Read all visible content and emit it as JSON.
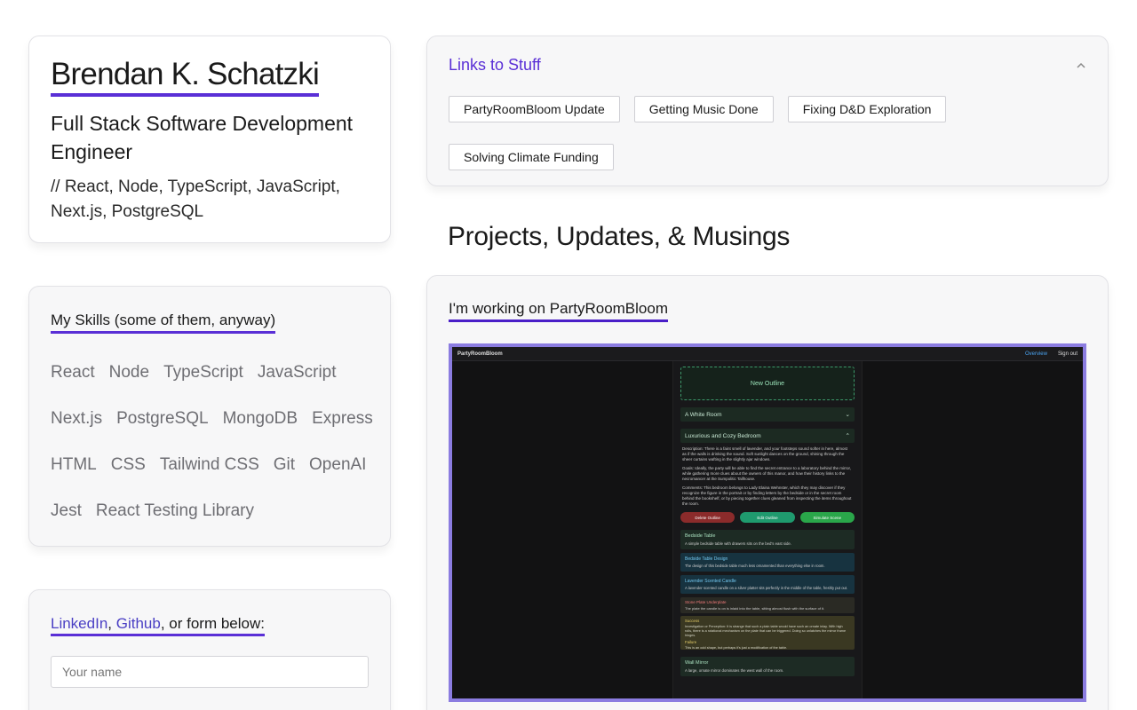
{
  "profile": {
    "name": "Brendan K. Schatzki",
    "role": "Full Stack Software Development Engineer",
    "stack": "// React, Node, TypeScript, JavaScript, Next.js, PostgreSQL"
  },
  "skills": {
    "heading": "My Skills (some of them, anyway)",
    "items": [
      "React",
      "Node",
      "TypeScript",
      "JavaScript",
      "Next.js",
      "PostgreSQL",
      "MongoDB",
      "Express",
      "HTML",
      "CSS",
      "Tailwind CSS",
      "Git",
      "OpenAI",
      "Jest",
      "React Testing Library"
    ]
  },
  "contact": {
    "linkedin": "LinkedIn",
    "separator": ",",
    "github": "Github",
    "suffix": ", or form below:",
    "name_placeholder": "Your name"
  },
  "links": {
    "title": "Links to Stuff",
    "items": [
      "PartyRoomBloom Update",
      "Getting Music Done",
      "Fixing D&D Exploration",
      "Solving Climate Funding"
    ]
  },
  "section": {
    "title": "Projects, Updates, & Musings"
  },
  "post": {
    "title": "I'm working on PartyRoomBloom",
    "screenshot": {
      "brand": "PartyRoomBloom",
      "nav_overview": "Overview",
      "nav_signout": "Sign out",
      "new_outline": "New Outline",
      "room_1": "A White Room",
      "room_2": "Luxurious and Cozy Bedroom",
      "description": "Description: There is a faint smell of lavender, and your footsteps sound softer in here, almost as if the walls is drinking the sound. Soft sunlight dances on the ground, shining through the sheer curtains wafting in the slightly ajar windows.",
      "goals": "Goals: Ideally, the party will be able to find the secret entrance to a laboratory behind the mirror, while gathering more clues about the owners of this manor, and how their history links to the necromancer at the Sumpolitic Tallhouse.",
      "comments": "Comments: This bedroom belongs to Lady Elaina Wehnster, which they may discover if they recognize the figure in the portrait or by finding letters by the bedside or in the secret room behind the bookshelf, or by piecing together clues gleaned from inspecting the items throughout the room.",
      "btn_delete": "Delete Outline",
      "btn_edit": "Edit Outline",
      "btn_simulate": "Simulate Scene",
      "sub_1_title": "Bedside Table",
      "sub_1_desc": "A simple bedside table with drawers sits on the bed's east side.",
      "sub_2_title": "Bedside Table Design",
      "sub_2_desc": "The design of this bedside table much less ornamented than everything else in room.",
      "sub_3_title": "Lavender Scented Candle",
      "sub_3_desc": "A lavender scented candle on a silver platter sits perfectly in the middle of the table, freshly put out.",
      "sub_4_title": "Stone Plate Underplate",
      "sub_4_desc": "The plate the candle is on is inlaid into the table, sitting almost flush with the surface of it.",
      "success_label": "Success",
      "success_text": "Investigation or Perception: It is strange that such a plain table would have such an ornate inlay. With high rolls, there is a rotational mechanism on the plate that can be triggered. Doing so unlatches the mirror frame hinges.",
      "failure_label": "Failure",
      "failure_text": "This is an odd shape, but perhaps it's just a modification of the table.",
      "sub_5_title": "Wall Mirror",
      "sub_5_desc": "A large, ornate mirror dominates the west wall of the room."
    }
  },
  "colors": {
    "accent": "#5a2fd6",
    "link": "#4a3fc4",
    "frame": "#8b7ce0"
  }
}
